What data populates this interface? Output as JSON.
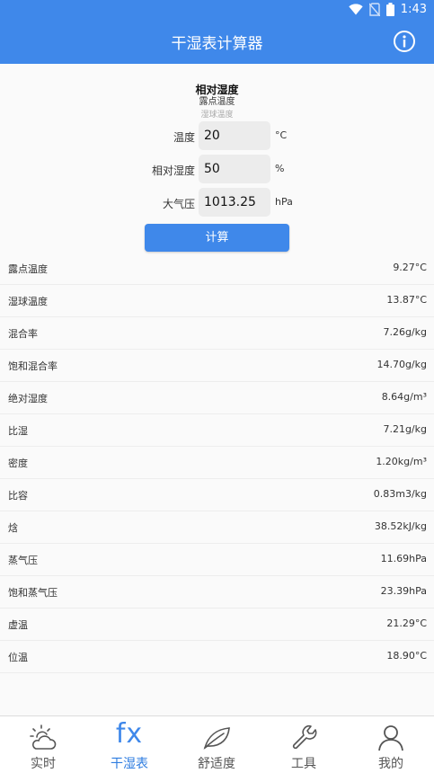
{
  "status_bar": {
    "time": "1:43",
    "icons": [
      "wifi-icon",
      "no-sim-icon",
      "battery-icon"
    ]
  },
  "app_bar": {
    "title": "干湿表计算器",
    "info_icon": "info-icon"
  },
  "picker": {
    "selected": "相对湿度",
    "option_2": "露点温度",
    "option_3": "湿球温度"
  },
  "form": {
    "temperature": {
      "label": "温度",
      "value": "20",
      "unit": "°C"
    },
    "humidity": {
      "label": "相对湿度",
      "value": "50",
      "unit": "%"
    },
    "pressure": {
      "label": "大气压",
      "value": "1013.25",
      "unit": "hPa"
    }
  },
  "calculate_button": "计算",
  "results": [
    {
      "label": "露点温度",
      "value": "9.27°C"
    },
    {
      "label": "湿球温度",
      "value": "13.87°C"
    },
    {
      "label": "混合率",
      "value": "7.26g/kg"
    },
    {
      "label": "饱和混合率",
      "value": "14.70g/kg"
    },
    {
      "label": "绝对湿度",
      "value": "8.64g/m³"
    },
    {
      "label": "比湿",
      "value": "7.21g/kg"
    },
    {
      "label": "密度",
      "value": "1.20kg/m³"
    },
    {
      "label": "比容",
      "value": "0.83m3/kg"
    },
    {
      "label": "焓",
      "value": "38.52kJ/kg"
    },
    {
      "label": "蒸气压",
      "value": "11.69hPa"
    },
    {
      "label": "饱和蒸气压",
      "value": "23.39hPa"
    },
    {
      "label": "虚温",
      "value": "21.29°C"
    },
    {
      "label": "位温",
      "value": "18.90°C"
    }
  ],
  "nav": {
    "items": [
      {
        "label": "实时",
        "icon": "weather-icon"
      },
      {
        "label": "干湿表",
        "icon": "fx-icon",
        "glyph": "fx",
        "active": true
      },
      {
        "label": "舒适度",
        "icon": "leaf-icon"
      },
      {
        "label": "工具",
        "icon": "wrench-icon"
      },
      {
        "label": "我的",
        "icon": "user-icon"
      }
    ]
  },
  "colors": {
    "primary": "#3f88ea",
    "background": "#fafafa",
    "field": "#ececec",
    "nav_active": "#2f7de0"
  }
}
